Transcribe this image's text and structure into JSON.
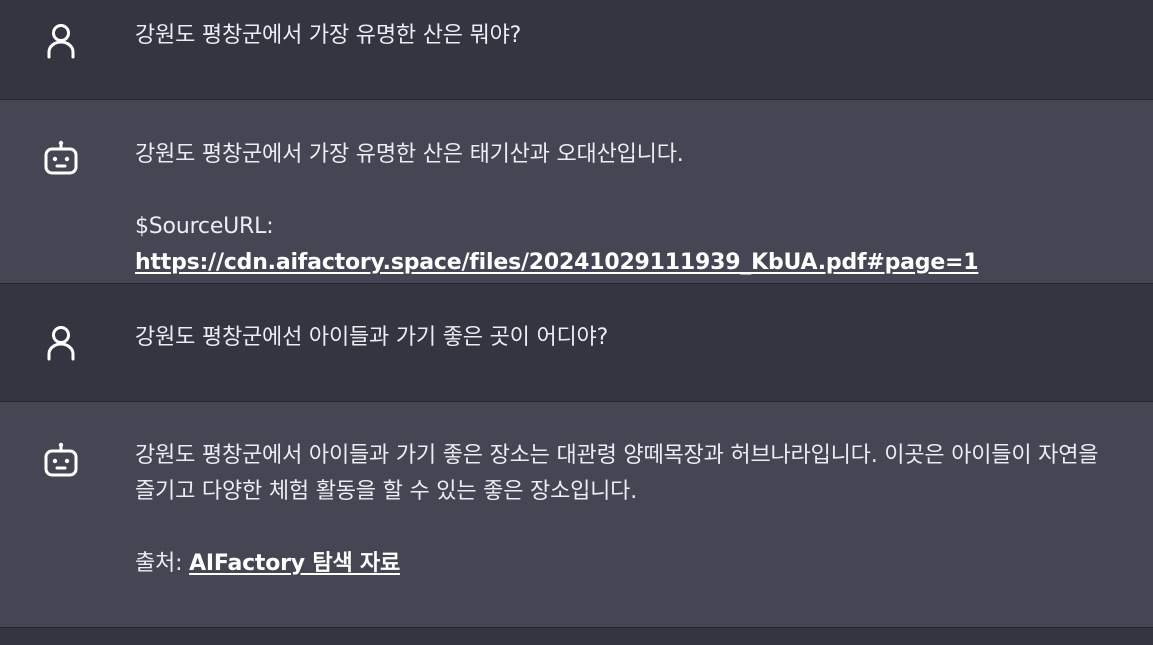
{
  "messages": [
    {
      "role": "user",
      "icon": "user-icon",
      "text": "강원도 평창군에서 가장 유명한 산은 뭐야?"
    },
    {
      "role": "assistant",
      "icon": "bot-icon",
      "text": "강원도 평창군에서 가장 유명한 산은 태기산과 오대산입니다.",
      "source_label": "$SourceURL: ",
      "source_link": "https://cdn.aifactory.space/files/20241029111939_KbUA.pdf#page=1"
    },
    {
      "role": "user",
      "icon": "user-icon",
      "text": "강원도 평창군에선 아이들과 가기 좋은 곳이 어디야?"
    },
    {
      "role": "assistant",
      "icon": "bot-icon",
      "text": "강원도 평창군에서 아이들과 가기 좋은 장소는 대관령 양떼목장과 허브나라입니다. 이곳은 아이들이 자연을 즐기고 다양한 체험 활동을 할 수 있는 좋은 장소입니다.",
      "source_label": "출처: ",
      "source_link": "AIFactory 탐색 자료"
    }
  ],
  "colors": {
    "user_bg": "#343541",
    "assistant_bg": "#444654",
    "text": "#ececf1"
  }
}
